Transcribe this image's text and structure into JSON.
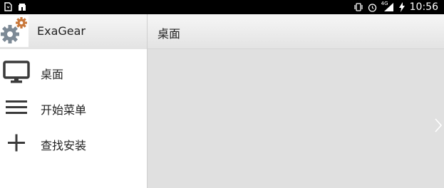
{
  "status_bar": {
    "time": "10:56",
    "network": "4G",
    "left_icons": [
      "file-icon",
      "store-icon"
    ],
    "right_icons": [
      "vibrate-icon",
      "alarm-icon",
      "signal-icon",
      "battery-charging-icon"
    ]
  },
  "app": {
    "title": "ExaGear",
    "logo_icon": "gears-icon"
  },
  "sidebar": {
    "items": [
      {
        "label": "桌面",
        "icon": "monitor-icon"
      },
      {
        "label": "开始菜单",
        "icon": "hamburger-menu-icon"
      },
      {
        "label": "查找安装",
        "icon": "plus-icon"
      }
    ]
  },
  "main": {
    "title": "桌面"
  },
  "colors": {
    "header_gradient_top": "#f6f6f6",
    "header_gradient_bottom": "#e3e3e3",
    "content_bg": "#e0e0e0",
    "sidebar_bg": "#ffffff",
    "icon_color": "#3a3a3a"
  }
}
